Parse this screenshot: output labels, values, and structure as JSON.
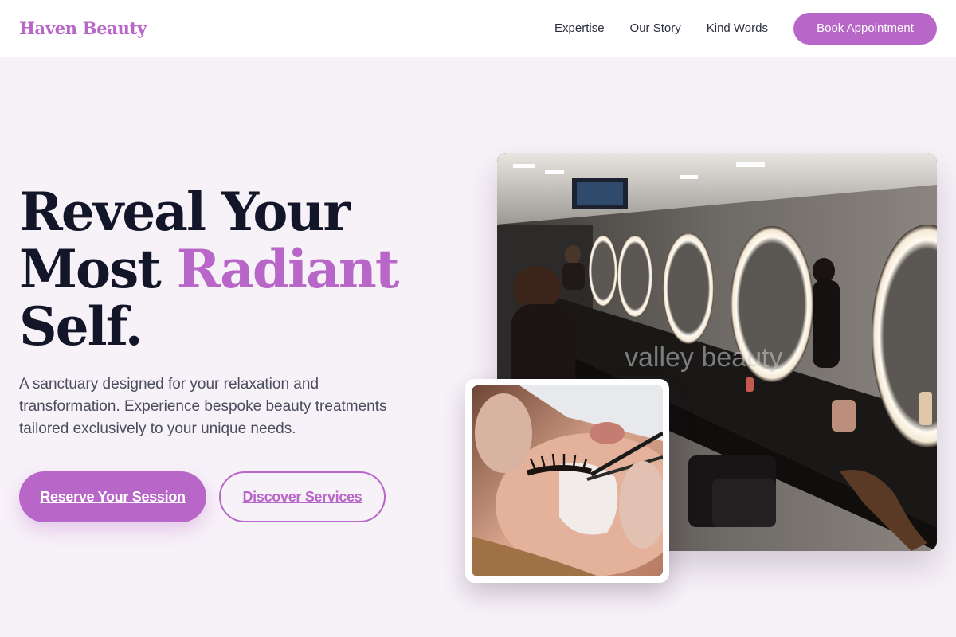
{
  "header": {
    "logo": "Haven Beauty",
    "nav": [
      {
        "label": "Expertise"
      },
      {
        "label": "Our Story"
      },
      {
        "label": "Kind Words"
      }
    ],
    "cta_label": "Book Appointment"
  },
  "hero": {
    "headline_line1": "Reveal Your",
    "headline_line2_start": "Most",
    "headline_accent": "Radiant",
    "headline_line3": "Self.",
    "subtitle": "A sanctuary designed for your relaxation and transformation. Experience bespoke beauty treatments tailored exclusively to your unique needs.",
    "primary_button": "Reserve Your Session",
    "secondary_button": "Discover Services"
  },
  "images": {
    "salon_watermark": "valley beauty"
  },
  "colors": {
    "accent": "#b866c7",
    "background": "#f7f1f8",
    "headline": "#121628",
    "body_text": "#4a4d5c"
  }
}
